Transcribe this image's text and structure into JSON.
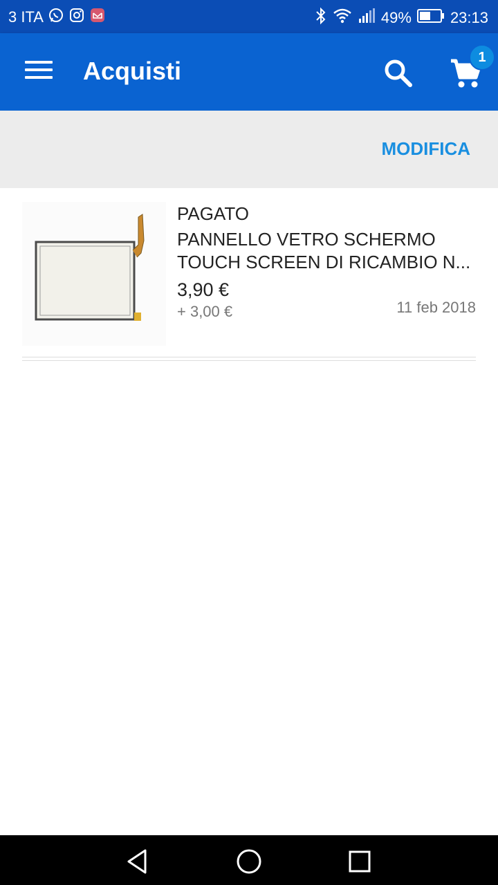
{
  "status_bar": {
    "carrier": "3 ITA",
    "battery": "49%",
    "time": "23:13"
  },
  "app_bar": {
    "title": "Acquisti",
    "cart_count": "1"
  },
  "toolbar": {
    "edit_label": "MODIFICA"
  },
  "purchases": [
    {
      "status": "PAGATO",
      "title": "PANNELLO VETRO SCHERMO TOUCH SCREEN DI RICAMBIO N...",
      "price": "3,90 €",
      "shipping": "+ 3,00 €",
      "date": "11 feb 2018"
    }
  ],
  "colors": {
    "status_bar": "#0b4db5",
    "app_bar": "#0a63d1",
    "accent": "#1a8fe0",
    "badge": "#0d8ce0"
  }
}
